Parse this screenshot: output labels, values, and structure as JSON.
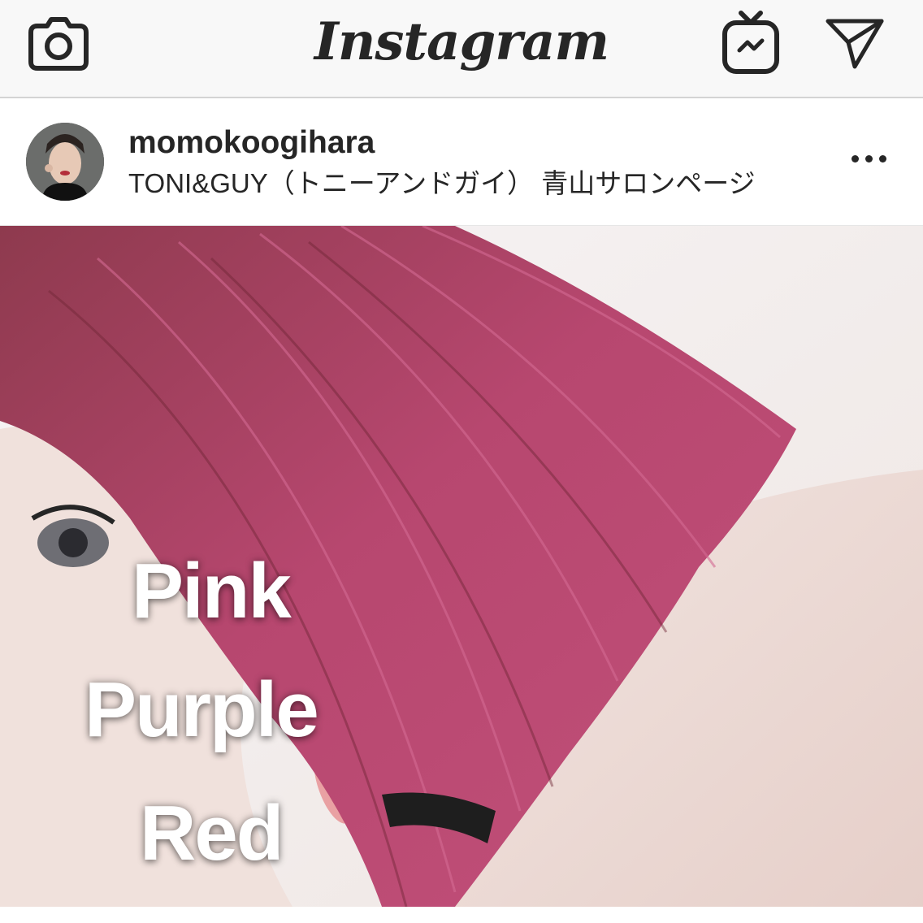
{
  "header": {
    "brand": "Instagram",
    "icons": {
      "left": "camera-icon",
      "right_1": "igtv-icon",
      "right_2": "direct-message-icon"
    }
  },
  "post": {
    "username": "momokoogihara",
    "location": "TONI&GUY（トニーアンドガイ） 青山サロンページ",
    "more_icon": "more-options-icon",
    "image": {
      "overlay_lines": [
        "Pink",
        "Purple",
        "Red"
      ],
      "dominant_colors": {
        "hair": "#b0476e",
        "skin": "#f3e6e2",
        "background": "#f2f0f2"
      }
    }
  },
  "colors": {
    "text": "#262626",
    "nav_background": "#f8f8f8",
    "divider": "#d4d4d4"
  }
}
